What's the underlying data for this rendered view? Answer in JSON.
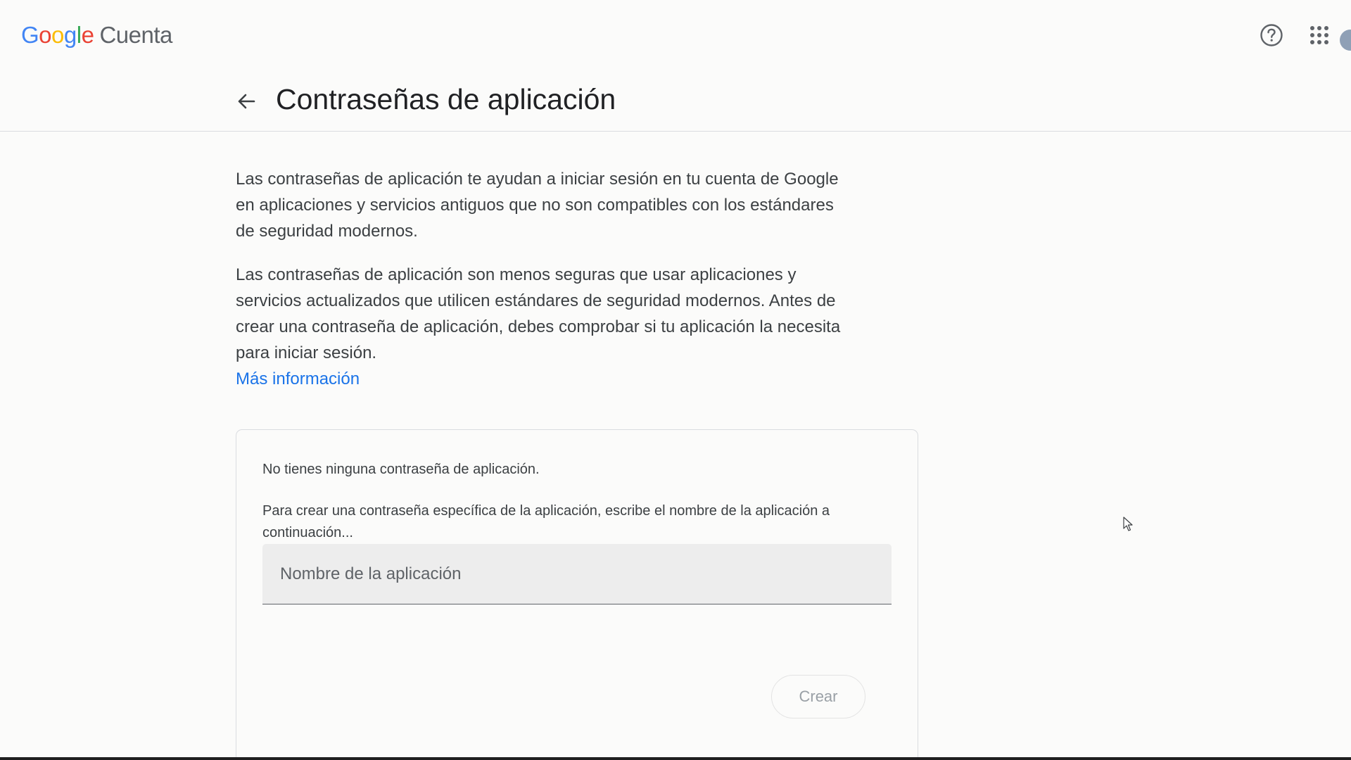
{
  "app": {
    "logo_letters": [
      {
        "char": "G",
        "color": "#4285F4"
      },
      {
        "char": "o",
        "color": "#EA4335"
      },
      {
        "char": "o",
        "color": "#FBBC05"
      },
      {
        "char": "g",
        "color": "#4285F4"
      },
      {
        "char": "l",
        "color": "#34A853"
      },
      {
        "char": "e",
        "color": "#EA4335"
      }
    ],
    "logo_text": "Google",
    "product_name": "Cuenta"
  },
  "topbar": {
    "help_icon": "help-circle-icon",
    "apps_icon": "apps-grid-icon",
    "avatar_icon": "account-avatar"
  },
  "header": {
    "back_icon": "arrow-left-icon",
    "title": "Contraseñas de aplicación"
  },
  "main": {
    "paragraph_1": "Las contraseñas de aplicación te ayudan a iniciar sesión en tu cuenta de Google en aplicaciones y servicios antiguos que no son compatibles con los estándares de seguridad modernos.",
    "paragraph_2": "Las contraseñas de aplicación son menos seguras que usar aplicaciones y servicios actualizados que utilicen estándares de seguridad modernos. Antes de crear una contraseña de aplicación, debes comprobar si tu aplicación la necesita para iniciar sesión.",
    "learn_more": "Más información",
    "link_color": "#1a73e8"
  },
  "card": {
    "empty_message": "No tienes ninguna contraseña de aplicación.",
    "instructions": "Para crear una contraseña específica de la aplicación, escribe el nombre de la aplicación a continuación...",
    "input_value": "",
    "input_placeholder": "Nombre de la aplicación",
    "create_button": "Crear"
  }
}
